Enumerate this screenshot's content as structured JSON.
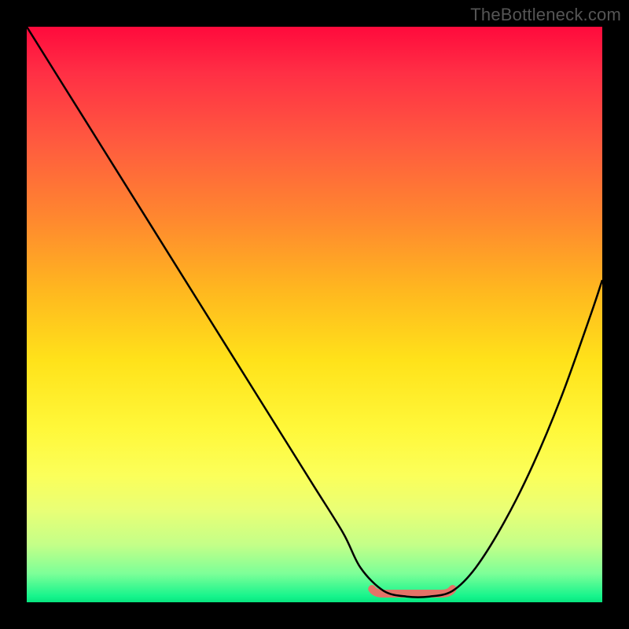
{
  "attribution": "TheBottleneck.com",
  "colors": {
    "background": "#000000",
    "curve": "#000000",
    "valley_marker": "#e57368"
  },
  "chart_data": {
    "type": "line",
    "title": "",
    "xlabel": "",
    "ylabel": "",
    "xlim": [
      0,
      100
    ],
    "ylim": [
      0,
      100
    ],
    "grid": false,
    "legend": false,
    "series": [
      {
        "name": "bottleneck-curve",
        "x": [
          0,
          5,
          10,
          15,
          20,
          25,
          30,
          35,
          40,
          45,
          50,
          55,
          58,
          62,
          66,
          70,
          74,
          78,
          83,
          88,
          93,
          98,
          100
        ],
        "y": [
          100,
          92,
          84,
          76,
          68,
          60,
          52,
          44,
          36,
          28,
          20,
          12,
          6,
          2,
          1,
          1,
          2,
          6,
          14,
          24,
          36,
          50,
          56
        ]
      }
    ],
    "annotations": [
      {
        "name": "valley-plateau",
        "x_range": [
          60,
          74
        ],
        "y": 1.5
      }
    ],
    "background_gradient_stops": [
      {
        "pos": 0.0,
        "color": "#ff0a3c"
      },
      {
        "pos": 0.08,
        "color": "#ff2f45"
      },
      {
        "pos": 0.2,
        "color": "#ff5a3f"
      },
      {
        "pos": 0.34,
        "color": "#ff8a2e"
      },
      {
        "pos": 0.46,
        "color": "#ffb81f"
      },
      {
        "pos": 0.58,
        "color": "#ffe21a"
      },
      {
        "pos": 0.7,
        "color": "#fff83a"
      },
      {
        "pos": 0.78,
        "color": "#fbff5a"
      },
      {
        "pos": 0.84,
        "color": "#e9ff76"
      },
      {
        "pos": 0.9,
        "color": "#c4ff88"
      },
      {
        "pos": 0.95,
        "color": "#7dff98"
      },
      {
        "pos": 0.99,
        "color": "#15f48c"
      },
      {
        "pos": 1.0,
        "color": "#08e47e"
      }
    ]
  }
}
